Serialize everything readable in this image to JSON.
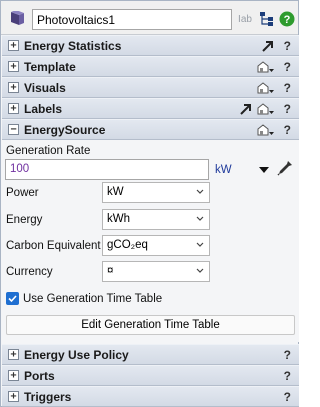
{
  "header": {
    "object_name": "Photovoltaics1",
    "label_tool": "Iab"
  },
  "sections": {
    "energy_statistics": "Energy Statistics",
    "template": "Template",
    "visuals": "Visuals",
    "labels": "Labels",
    "energy_source": "EnergySource",
    "energy_use_policy": "Energy Use Policy",
    "ports": "Ports",
    "triggers": "Triggers"
  },
  "expander": {
    "collapsed": "+",
    "expanded": "−"
  },
  "help_label": "?",
  "energy_source": {
    "generation_rate_label": "Generation Rate",
    "generation_rate_value": "100",
    "generation_rate_unit": "kW",
    "power_label": "Power",
    "power_value": "kW",
    "energy_label": "Energy",
    "energy_value": "kWh",
    "carbon_label": "Carbon Equivalent",
    "carbon_value": "gCO₂eq",
    "currency_label": "Currency",
    "currency_value": "¤",
    "use_table_label": "Use Generation Time Table",
    "use_table_checked": true,
    "edit_table_button": "Edit Generation Time Table"
  },
  "colors": {
    "section_bg": "#d9dfe9",
    "value_purple": "#7030a0",
    "unit_blue": "#1f3a9b",
    "checkbox_blue": "#1f6fd1",
    "help_green": "#2e9b2e"
  }
}
